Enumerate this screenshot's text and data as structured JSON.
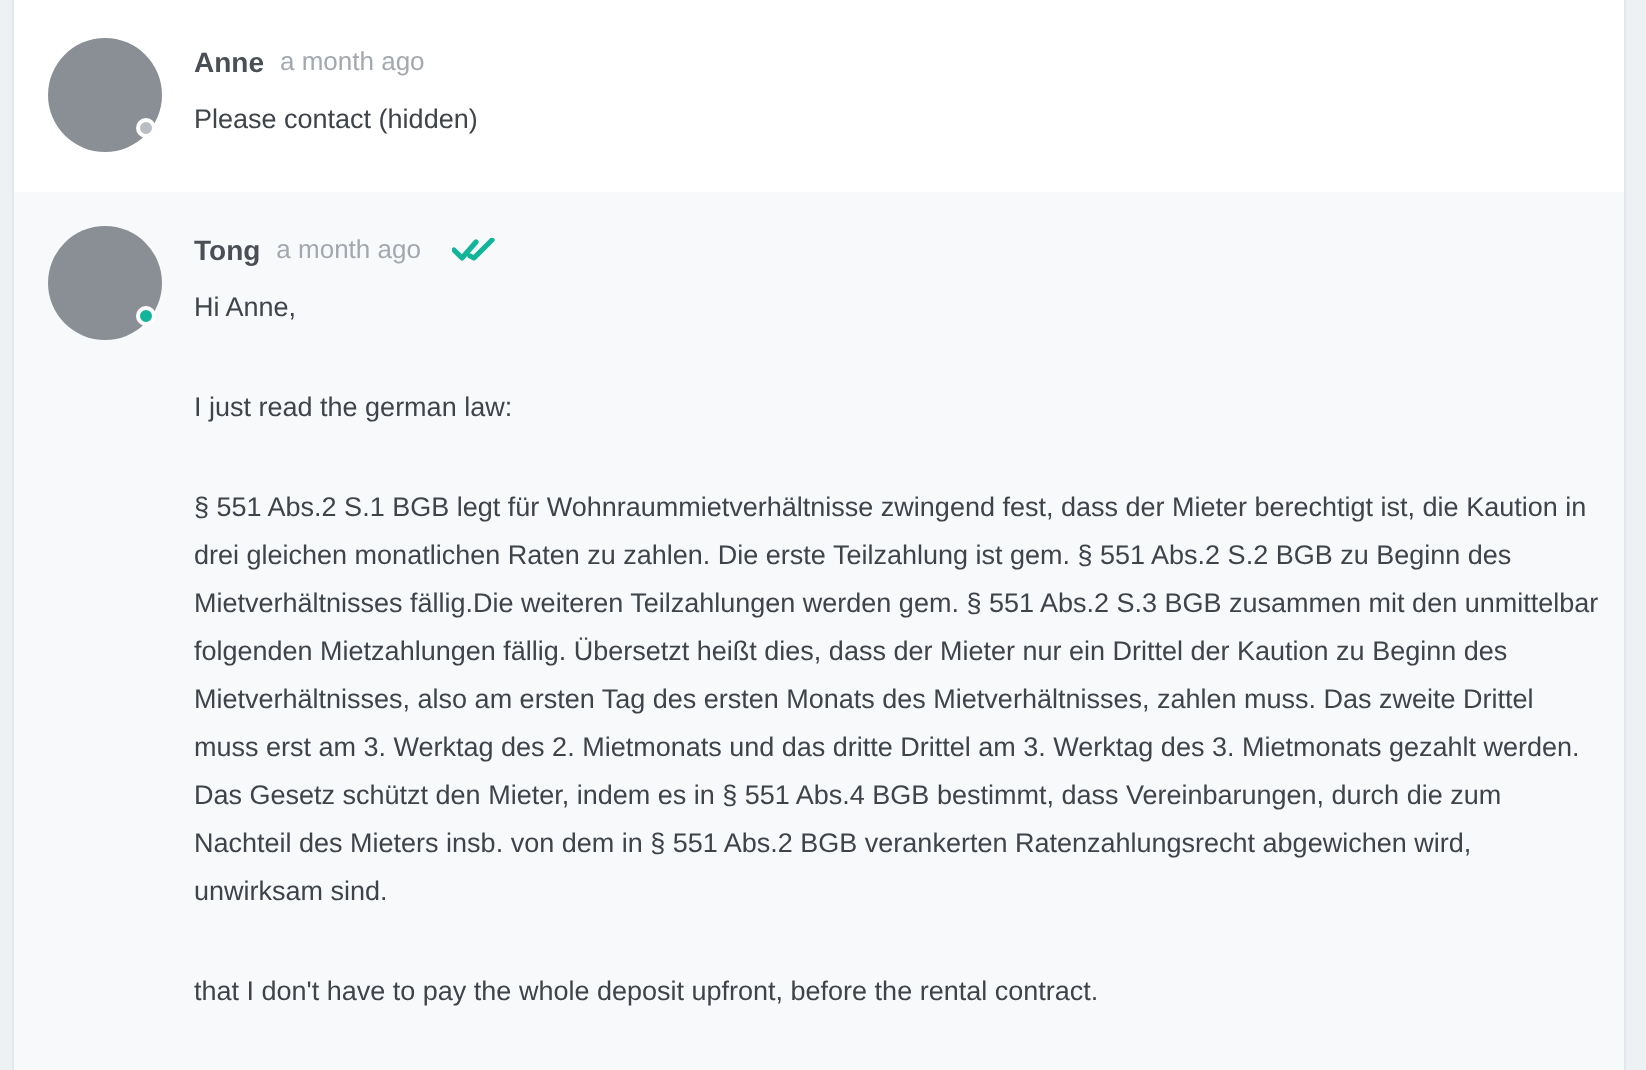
{
  "messages": [
    {
      "author": "Anne",
      "time": "a month ago",
      "online": false,
      "read": false,
      "paragraphs": [
        "Please contact (hidden)"
      ]
    },
    {
      "author": "Tong",
      "time": "a month ago",
      "online": true,
      "read": true,
      "paragraphs": [
        "Hi Anne,",
        "I just read the german law:",
        "§ 551 Abs.2 S.1 BGB legt für Wohnraummietverhältnisse zwingend fest, dass der Mieter berechtigt ist, die Kaution in drei gleichen monatlichen Raten zu zahlen. Die erste Teilzahlung ist gem. § 551 Abs.2 S.2 BGB zu Beginn des Mietverhältnisses fällig.Die weiteren Teilzahlungen werden gem. § 551 Abs.2 S.3 BGB zusammen mit den unmittelbar folgenden Mietzahlungen fällig. Übersetzt heißt dies, dass der Mieter nur ein Drittel der Kaution zu Beginn des Mietverhältnisses, also am ersten Tag des ersten Monats des Mietverhältnisses, zahlen muss. Das zweite Drittel muss erst am 3. Werktag des 2. Mietmonats und das dritte Drittel am 3. Werktag des 3. Mietmonats gezahlt werden. Das Gesetz schützt den Mieter, indem es in § 551 Abs.4 BGB bestimmt, dass Vereinbarungen, durch die zum Nachteil des Mieters insb. von dem in § 551 Abs.2 BGB verankerten Ratenzahlungsrecht abgewichen wird, unwirksam sind.",
        "that I don't have to pay the whole deposit upfront, before the rental contract."
      ]
    }
  ]
}
